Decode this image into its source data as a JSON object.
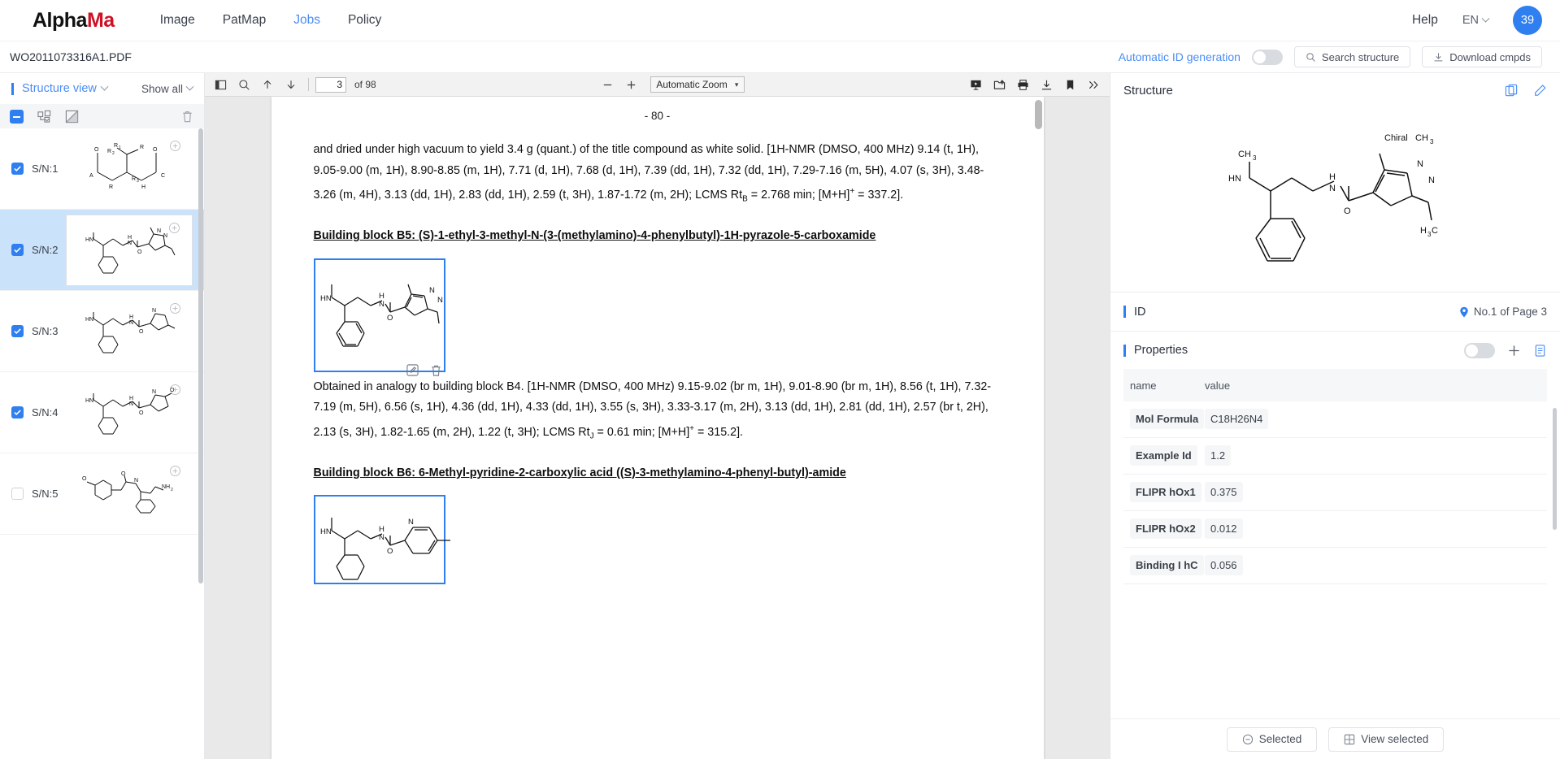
{
  "header": {
    "logo_prefix": "Alpha",
    "logo_suffix": "Ma",
    "nav": [
      {
        "label": "Image",
        "active": false
      },
      {
        "label": "PatMap",
        "active": false
      },
      {
        "label": "Jobs",
        "active": true
      },
      {
        "label": "Policy",
        "active": false
      }
    ],
    "help_label": "Help",
    "language": "EN",
    "avatar_count": "39"
  },
  "subbar": {
    "document_name": "WO2011073316A1.PDF",
    "auto_id_label": "Automatic ID generation",
    "auto_id_on": false,
    "search_structure": "Search structure",
    "download_cmpds": "Download cmpds"
  },
  "sidebar": {
    "title": "Structure view",
    "show_all": "Show all",
    "items": [
      {
        "label": "S/N:1",
        "checked": true,
        "selected": false
      },
      {
        "label": "S/N:2",
        "checked": true,
        "selected": true
      },
      {
        "label": "S/N:3",
        "checked": true,
        "selected": false
      },
      {
        "label": "S/N:4",
        "checked": true,
        "selected": false
      },
      {
        "label": "S/N:5",
        "checked": false,
        "selected": false
      }
    ]
  },
  "pdf_toolbar": {
    "page_current": "3",
    "page_total": "of 98",
    "zoom_level": "Automatic Zoom"
  },
  "document": {
    "page_number": "- 80 -",
    "paragraph1": "and dried under high vacuum to yield 3.4 g (quant.) of the title compound as white solid. [1H-NMR (DMSO, 400 MHz) 9.14 (t, 1H), 9.05-9.00 (m, 1H), 8.90-8.85 (m, 1H), 7.71 (d, 1H), 7.68 (d, 1H), 7.39 (dd, 1H), 7.32 (dd, 1H), 7.29-7.16 (m, 5H), 4.07 (s, 3H), 3.48-3.26 (m, 4H), 3.13 (dd, 1H), 2.83 (dd, 1H), 2.59 (t, 3H), 1.87-1.72 (m, 2H); LCMS Rt",
    "paragraph1_sub": "B",
    "paragraph1_cont": " = 2.768 min; [M+H]",
    "paragraph1_sup": "+",
    "paragraph1_end": " = 337.2].",
    "heading_b5": "Building block B5: (S)-1-ethyl-3-methyl-N-(3-(methylamino)-4-phenylbutyl)-1H-pyrazole-5-carboxamide",
    "paragraph2": "Obtained in analogy to building block B4. [1H-NMR (DMSO, 400 MHz) 9.15-9.02 (br m, 1H), 9.01-8.90 (br m, 1H), 8.56 (t, 1H), 7.32-7.19 (m, 5H), 6.56 (s, 1H), 4.36 (dd, 1H), 4.33 (dd, 1H), 3.55 (s, 3H), 3.33-3.17 (m, 2H), 3.13 (dd, 1H), 2.81 (dd, 1H), 2.57 (br t, 2H), 2.13 (s, 3H), 1.82-1.65 (m, 2H), 1.22 (t, 3H); LCMS Rt",
    "paragraph2_sub": "J",
    "paragraph2_cont": " = 0.61 min; [M+H]",
    "paragraph2_sup": "+",
    "paragraph2_end": " = 315.2].",
    "heading_b6": "Building block B6: 6-Methyl-pyridine-2-carboxylic acid ((S)-3-methylamino-4-phenyl-butyl)-amide"
  },
  "right_panel": {
    "title": "Structure",
    "chiral_label": "Chiral",
    "id_label": "ID",
    "id_value": "No.1 of Page 3",
    "properties_label": "Properties",
    "properties_toggle_on": false,
    "table_headers": [
      "name",
      "value"
    ],
    "rows": [
      {
        "name": "Mol Formula",
        "value": "C18H26N4"
      },
      {
        "name": "Example Id",
        "value": "1.2"
      },
      {
        "name": "FLIPR hOx1",
        "value": "0.375"
      },
      {
        "name": "FLIPR hOx2",
        "value": "0.012"
      },
      {
        "name": "Binding I hC",
        "value": "0.056"
      }
    ],
    "footer": {
      "selected": "Selected",
      "view_selected": "View selected"
    }
  },
  "colors": {
    "accent": "#2f7ff0",
    "link": "#4a8cf7",
    "logo_red": "#cf1025",
    "selected_row": "#cbe2fb"
  }
}
